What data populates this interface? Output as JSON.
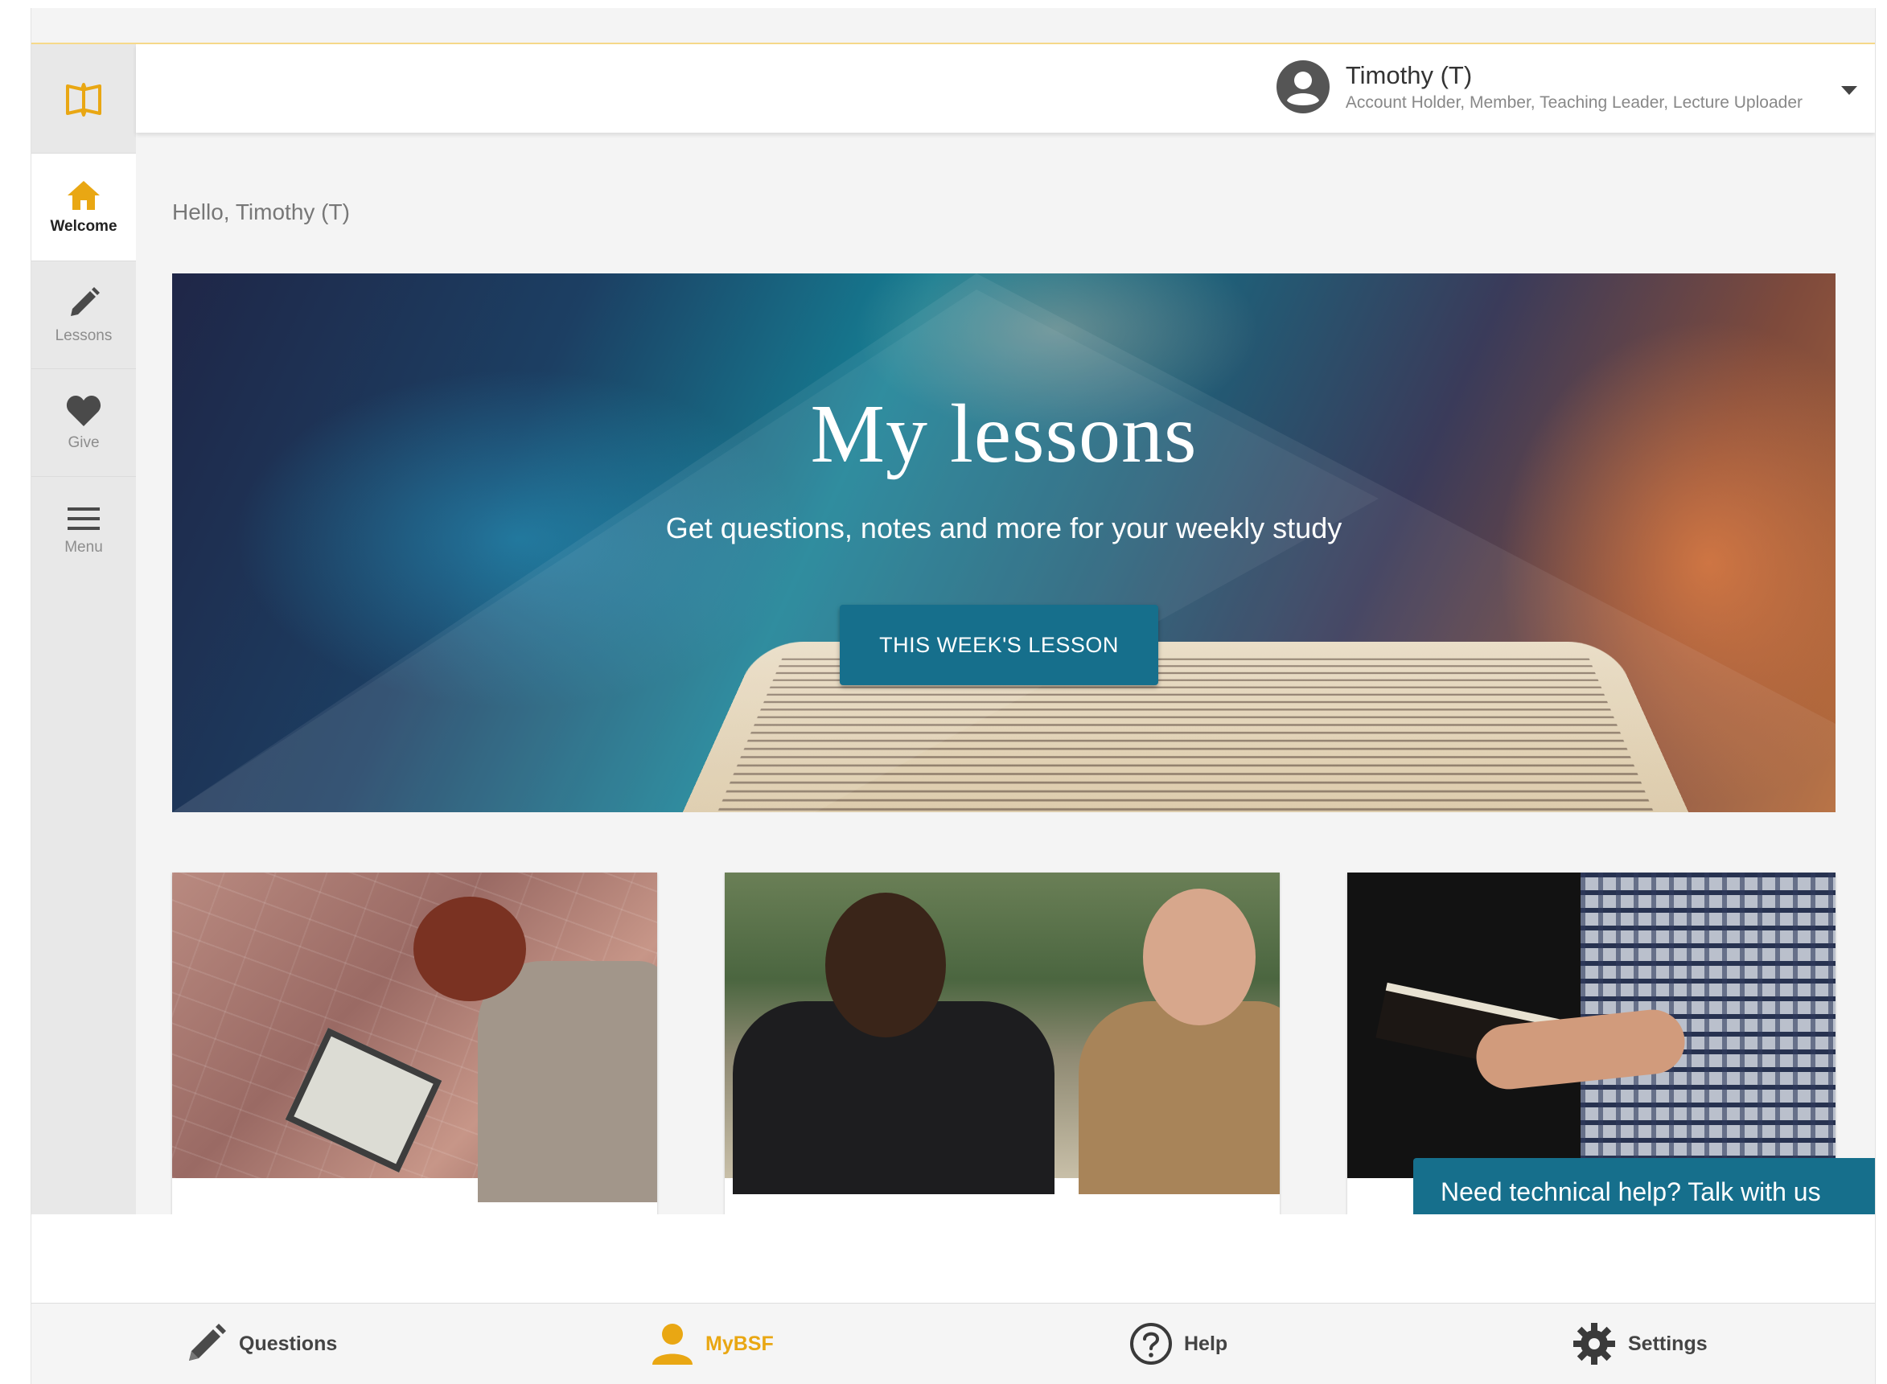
{
  "colors": {
    "accent": "#e9a713",
    "primary_teal": "#166f8c",
    "sidebar_bg": "#e8e8e8",
    "page_bg": "#f4f4f4"
  },
  "sidebar": {
    "logo_icon": "open-book-logo-icon",
    "items": [
      {
        "label": "Welcome",
        "icon": "home-icon",
        "active": true
      },
      {
        "label": "Lessons",
        "icon": "pencil-icon",
        "active": false
      },
      {
        "label": "Give",
        "icon": "heart-icon",
        "active": false
      },
      {
        "label": "Menu",
        "icon": "hamburger-menu-icon",
        "active": false
      }
    ]
  },
  "header": {
    "user_name": "Timothy (T)",
    "user_roles": "Account Holder, Member, Teaching Leader, Lecture Uploader",
    "avatar_icon": "account-circle-icon",
    "dropdown_icon": "caret-down-icon"
  },
  "main": {
    "greeting": "Hello, Timothy (T)",
    "hero": {
      "title": "My lessons",
      "subtitle": "Get questions, notes and more for your weekly study",
      "button_label": "THIS WEEK'S LESSON"
    },
    "help_chip": "Need technical help? Talk with us"
  },
  "bottom_nav": {
    "items": [
      {
        "label": "Questions",
        "icon": "pencil-icon",
        "active": false
      },
      {
        "label": "MyBSF",
        "icon": "person-icon",
        "active": true
      },
      {
        "label": "Help",
        "icon": "help-circle-icon",
        "active": false
      },
      {
        "label": "Settings",
        "icon": "gear-icon",
        "active": false
      }
    ]
  }
}
